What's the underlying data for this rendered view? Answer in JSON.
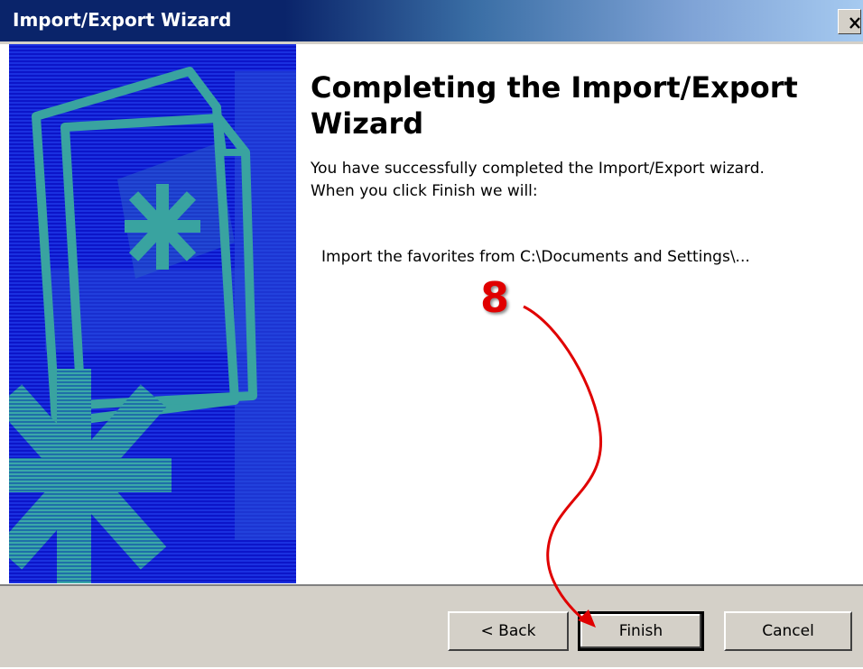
{
  "window": {
    "title": "Import/Export Wizard",
    "close_glyph": "x"
  },
  "content": {
    "heading": "Completing the Import/Export Wizard",
    "description": "You have successfully completed the Import/Export wizard.  When you click Finish we will:",
    "import_line": "Import the favorites from C:\\Documents and Settings\\..."
  },
  "buttons": {
    "back": "< Back",
    "finish": "Finish",
    "cancel": "Cancel"
  },
  "annotation": {
    "step_number": "8",
    "color": "#e00000"
  },
  "colors": {
    "titlebar_start": "#0a246a",
    "panel_background": "#0c15c9",
    "panel_art": "#2f9a9a",
    "dialog_face": "#d4d0c8"
  },
  "icons": [
    "close-icon",
    "wizard-illustration",
    "annotation-arrow"
  ]
}
